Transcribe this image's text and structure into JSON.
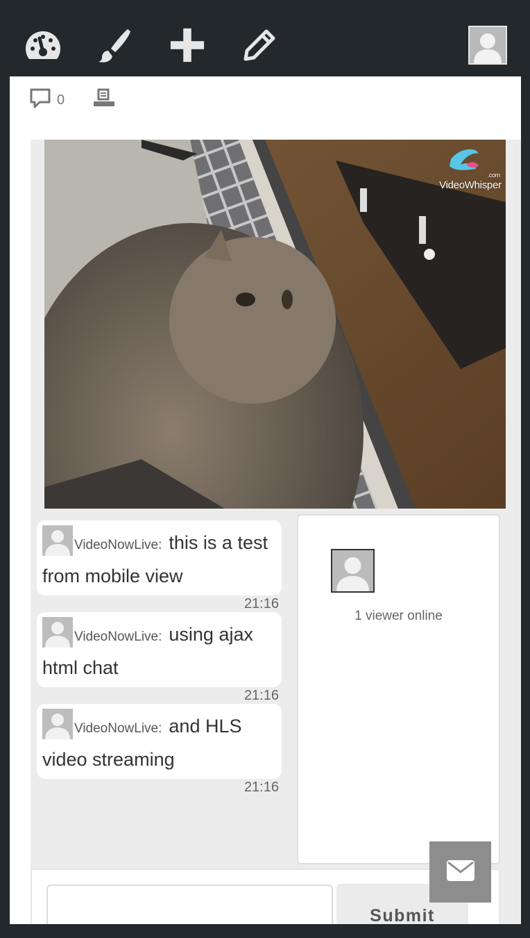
{
  "toolbar": {
    "icons": [
      "dashboard-icon",
      "brush-icon",
      "plus-icon",
      "pencil-icon"
    ],
    "avatar_icon": "user-avatar-icon"
  },
  "post_meta": {
    "comment_count": "0",
    "comment_icon": "comment-icon",
    "print_icon": "print-icon"
  },
  "video": {
    "watermark": "VideoWhisper",
    "watermark_sup": ".com"
  },
  "chat": {
    "messages": [
      {
        "author": "VideoNowLive:",
        "text": "this is a test from mobile view",
        "time": "21:16"
      },
      {
        "author": "VideoNowLive:",
        "text": "using ajax html chat",
        "time": "21:16"
      },
      {
        "author": "VideoNowLive:",
        "text": "and HLS video streaming",
        "time": "21:16"
      }
    ]
  },
  "viewers": {
    "count_text": "1 viewer online"
  },
  "composer": {
    "input_value": "",
    "submit_label": "Submit"
  },
  "floating": {
    "icon": "envelope-icon"
  },
  "colors": {
    "topbar": "#23282d",
    "stage_bg": "#ececec",
    "bubble_bg": "#ffffff",
    "mail_button": "#8d8d8d"
  }
}
